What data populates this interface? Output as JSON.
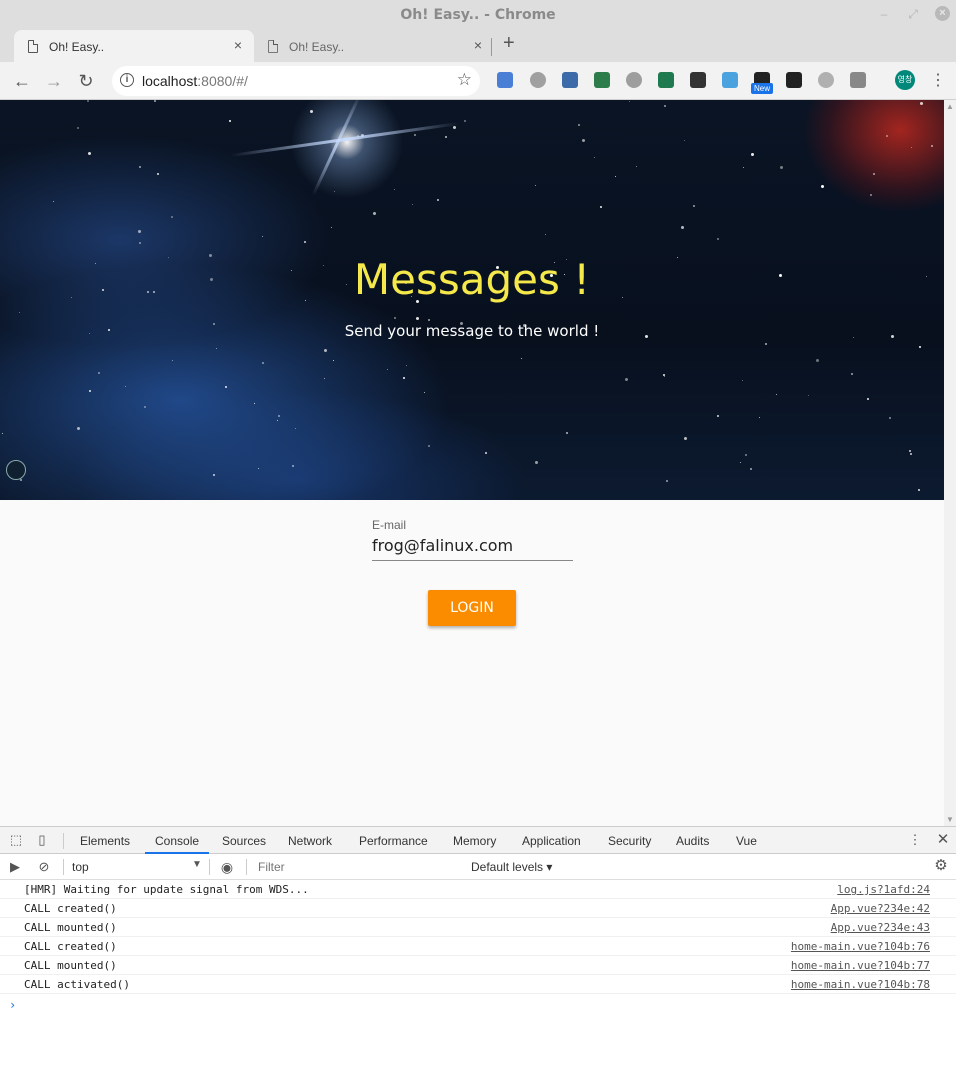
{
  "window": {
    "title": "Oh! Easy.. - Chrome",
    "close_glyph": "×",
    "minimize_glyph": "–",
    "maximize_glyph": "⤢"
  },
  "tabs": [
    {
      "label": "Oh! Easy..",
      "active": true,
      "close": "×"
    },
    {
      "label": "Oh! Easy..",
      "active": false,
      "close": "×"
    }
  ],
  "new_tab_glyph": "+",
  "toolbar": {
    "back": "←",
    "forward": "→",
    "reload": "↻",
    "url_host": "localhost",
    "url_rest": ":8080/#/",
    "star": "☆",
    "new_badge": "New",
    "avatar_text": "영창",
    "menu": "⋮"
  },
  "extensions": [
    {
      "name": "translate-icon",
      "color": "#4a7fd6"
    },
    {
      "name": "globe-icon",
      "color": "#a0a0a0"
    },
    {
      "name": "screen-capture-icon",
      "color": "#3d6aa8"
    },
    {
      "name": "image-icon",
      "color": "#2d7d4a"
    },
    {
      "name": "gear-extension-icon",
      "color": "#9e9e9e"
    },
    {
      "name": "vue-devtools-icon",
      "color": "#1f7a4f"
    },
    {
      "name": "font-icon",
      "color": "#333333"
    },
    {
      "name": "app-icon",
      "color": "#4aa3df"
    },
    {
      "name": "speed-icon",
      "color": "#222222"
    },
    {
      "name": "terminal-icon",
      "color": "#222222"
    },
    {
      "name": "discord-icon",
      "color": "#b0b0b0"
    },
    {
      "name": "camera-icon",
      "color": "#888888"
    }
  ],
  "hero": {
    "title": "Messages !",
    "subtitle": "Send your message to the world !"
  },
  "form": {
    "email_label": "E-mail",
    "email_value": "frog@falinux.com",
    "login_label": "LOGIN"
  },
  "devtools": {
    "tabs": [
      "Elements",
      "Console",
      "Sources",
      "Network",
      "Performance",
      "Memory",
      "Application",
      "Security",
      "Audits",
      "Vue"
    ],
    "active_tab": "Console",
    "context": "top",
    "filter_placeholder": "Filter",
    "levels": "Default levels ▾",
    "logs": [
      {
        "msg": "[HMR] Waiting for update signal from WDS...",
        "src": "log.js?1afd:24"
      },
      {
        "msg": "CALL created()",
        "src": "App.vue?234e:42"
      },
      {
        "msg": "CALL mounted()",
        "src": "App.vue?234e:43"
      },
      {
        "msg": "CALL created()",
        "src": "home-main.vue?104b:76"
      },
      {
        "msg": "CALL mounted()",
        "src": "home-main.vue?104b:77"
      },
      {
        "msg": "CALL activated()",
        "src": "home-main.vue?104b:78"
      }
    ],
    "prompt": "›"
  }
}
